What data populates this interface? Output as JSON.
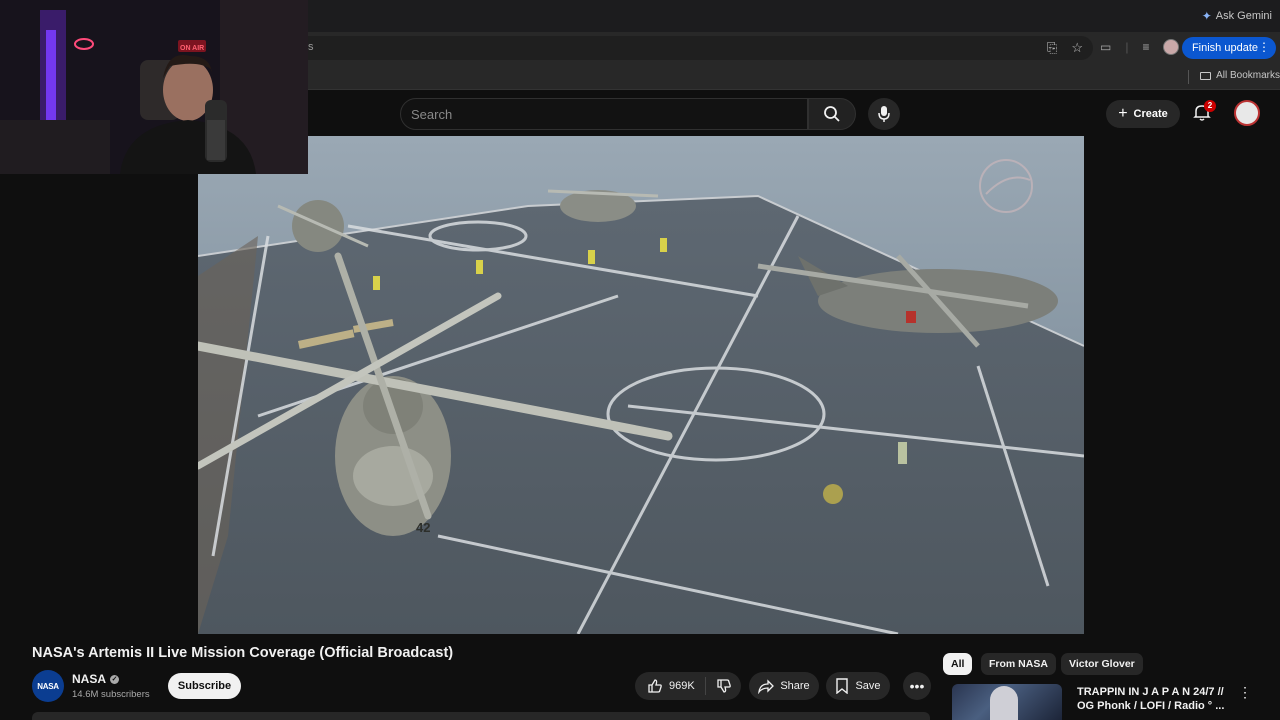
{
  "browser": {
    "ask_gemini": "Ask Gemini",
    "finish_update": "Finish update",
    "all_bookmarks": "All Bookmarks",
    "omnibox_visible_text": "s"
  },
  "header": {
    "search_placeholder": "Search",
    "create_label": "Create",
    "notification_count": "2"
  },
  "webcam": {
    "on_air_sign": "ON AIR"
  },
  "video": {
    "title": "NASA's Artemis II Live Mission Coverage (Official Broadcast)",
    "deck_number": "42"
  },
  "channel": {
    "avatar_text": "NASA",
    "name": "NASA",
    "subscribers": "14.6M subscribers",
    "subscribe_label": "Subscribe"
  },
  "actions": {
    "likes": "969K",
    "share_label": "Share",
    "save_label": "Save"
  },
  "chips": [
    {
      "label": "All",
      "active": true
    },
    {
      "label": "From NASA",
      "active": false
    },
    {
      "label": "Victor Glover",
      "active": false
    }
  ],
  "recommended": [
    {
      "title": "TRAPPIN IN  J A P A N  24/7 // OG Phonk / LOFI / Radio ° ..."
    }
  ],
  "icons": [
    "sparkle-icon",
    "install-icon",
    "star-icon",
    "search-icon",
    "mic-icon",
    "plus-icon",
    "bell-icon",
    "thumbs-up-icon",
    "thumbs-down-icon",
    "share-icon",
    "bookmark-icon",
    "more-icon",
    "kebab-icon",
    "folder-icon",
    "verified-icon"
  ],
  "colors": {
    "background": "#0f0f0f",
    "finish_update_bg": "#0b57d0",
    "notification_badge": "#cc0000",
    "deck": "#56606a",
    "ocean": "#7d8f9e"
  }
}
